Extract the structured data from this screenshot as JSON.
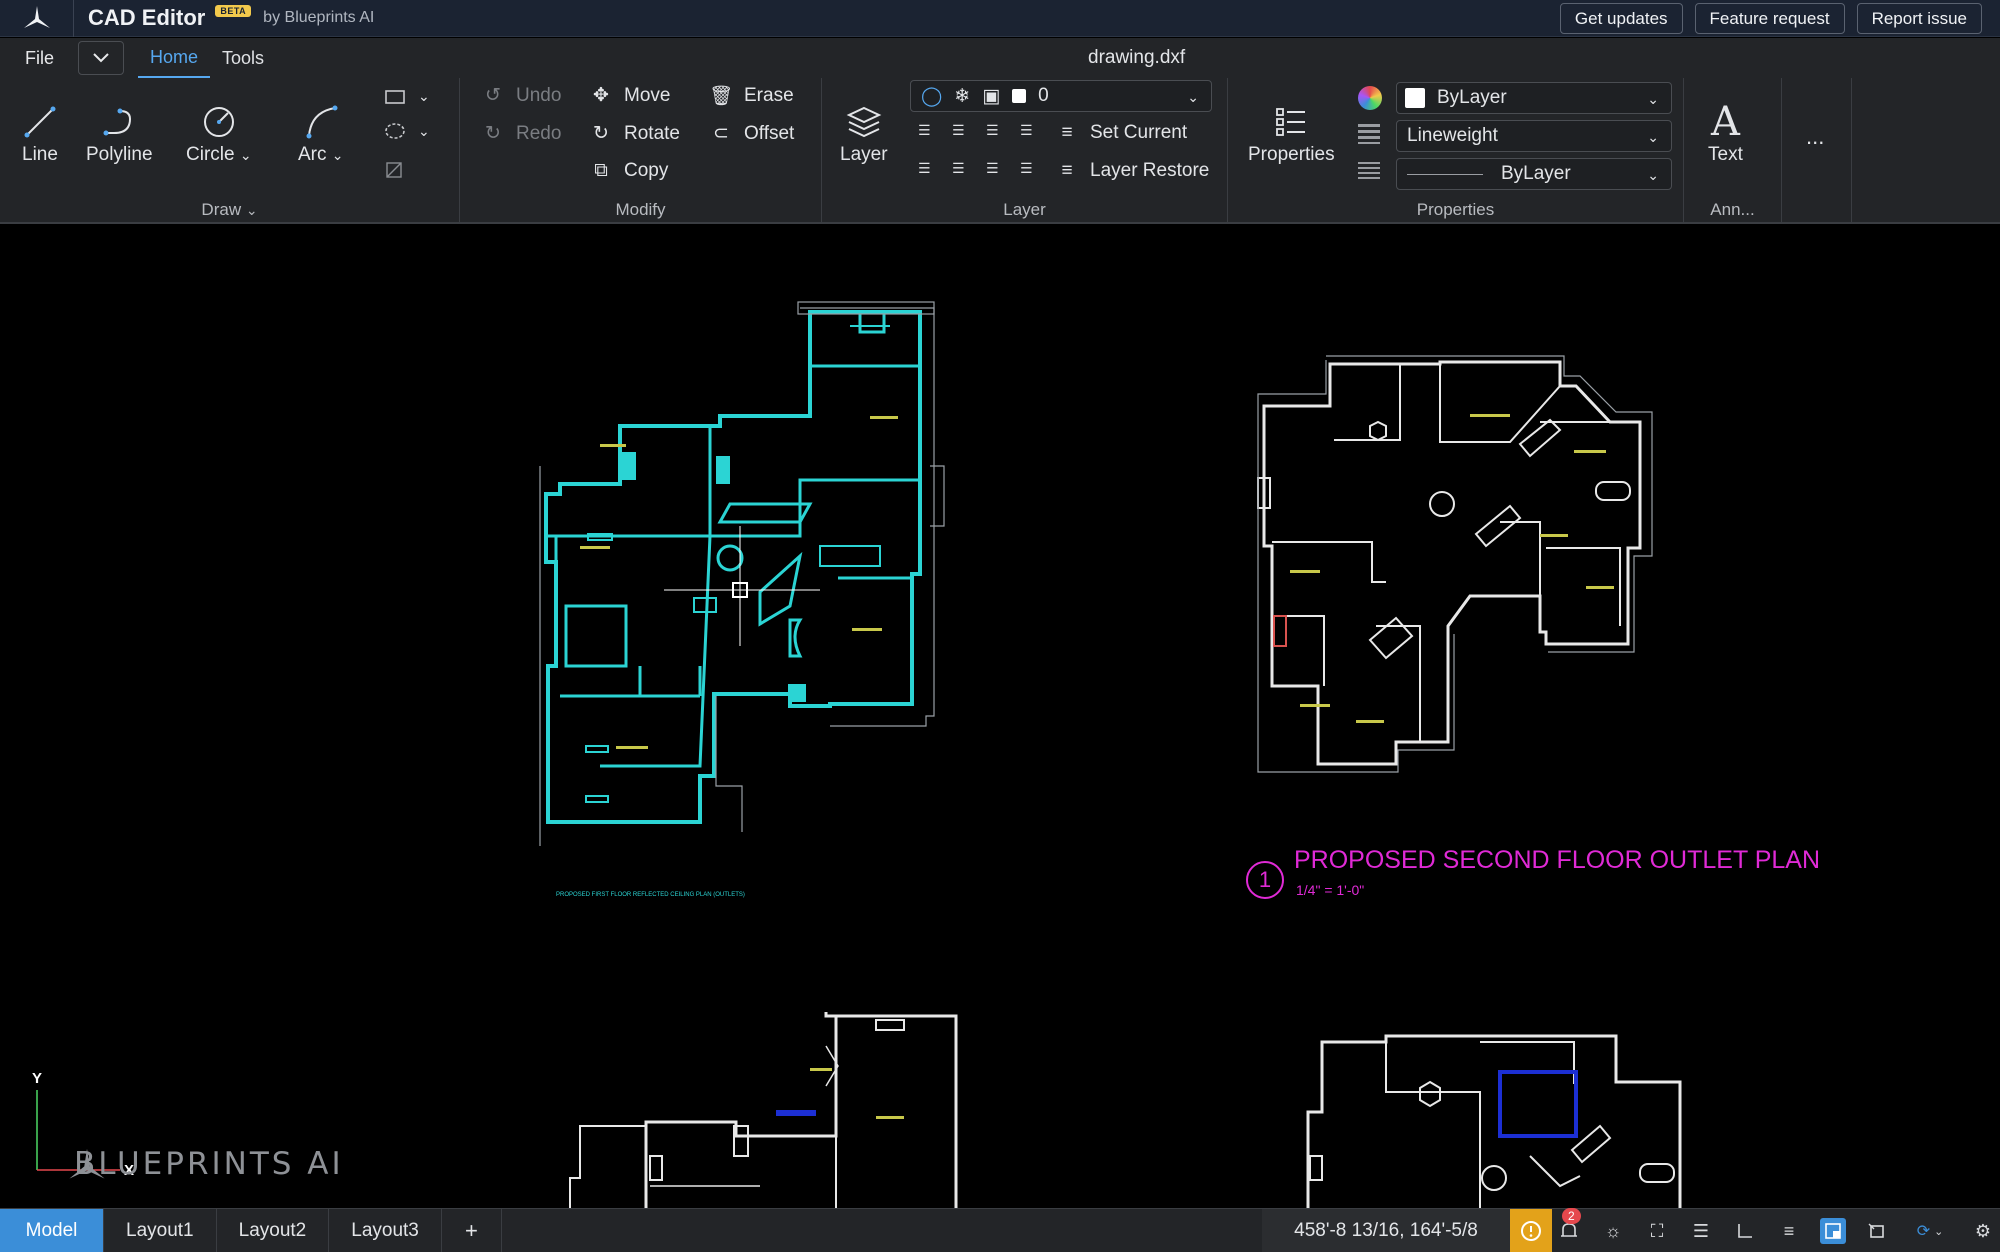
{
  "titlebar": {
    "app_name": "CAD Editor",
    "beta_badge": "BETA",
    "by_line": "by Blueprints AI",
    "buttons": [
      "Get updates",
      "Feature request",
      "Report issue"
    ]
  },
  "menubar": {
    "file": "File",
    "tabs": [
      "Home",
      "Tools"
    ],
    "active_tab": "Home",
    "filename": "drawing.dxf"
  },
  "ribbon": {
    "draw": {
      "label": "Draw",
      "tools": [
        "Line",
        "Polyline",
        "Circle",
        "Arc"
      ]
    },
    "modify": {
      "label": "Modify",
      "undo": "Undo",
      "redo": "Redo",
      "move": "Move",
      "rotate": "Rotate",
      "copy": "Copy",
      "erase": "Erase",
      "offset": "Offset"
    },
    "layer": {
      "label": "Layer",
      "button": "Layer",
      "current_layer": "0",
      "set_current": "Set Current",
      "layer_restore": "Layer Restore"
    },
    "properties": {
      "label": "Properties",
      "button": "Properties",
      "color": "ByLayer",
      "lineweight": "Lineweight",
      "linetype": "ByLayer"
    },
    "annotation": {
      "label": "Ann...",
      "text": "Text",
      "more": "..."
    }
  },
  "canvas": {
    "plan_number": "1",
    "plan_title": "PROPOSED SECOND FLOOR OUTLET PLAN",
    "plan_scale": "1/4\" = 1'-0\"",
    "small_caption": "PROPOSED FIRST FLOOR REFLECTED CEILING PLAN (OUTLETS)",
    "watermark": "BLUEPRINTS AI",
    "axis_y": "Y",
    "axis_x": "X"
  },
  "statusbar": {
    "layouts": [
      "Model",
      "Layout1",
      "Layout2",
      "Layout3"
    ],
    "active_layout": "Model",
    "add": "+",
    "coordinates": "458'-8 13/16, 164'-5/8",
    "notification_count": "2"
  },
  "colors": {
    "titlebar_bg": "#1b2332",
    "ribbon_bg": "#232528",
    "accent": "#3b8ed8",
    "selected_plan": "#2bd4d4",
    "annotation_magenta": "#e02ad6",
    "warning": "#e3a21a"
  }
}
